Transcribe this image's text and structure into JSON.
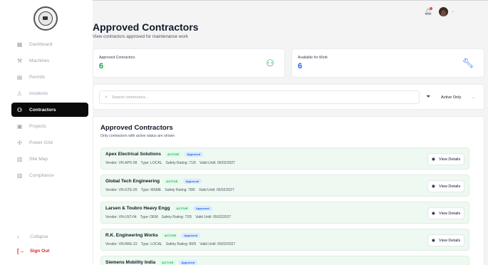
{
  "sidebar": {
    "items": [
      {
        "label": "Dashboard",
        "icon": "dashboard-icon",
        "glyph": "▦",
        "active": false
      },
      {
        "label": "Machines",
        "icon": "wrench-icon",
        "glyph": "⚒",
        "active": false
      },
      {
        "label": "Permits",
        "icon": "document-icon",
        "glyph": "▤",
        "active": false
      },
      {
        "label": "Incidents",
        "icon": "warning-icon",
        "glyph": "⚠",
        "active": false
      },
      {
        "label": "Contractors",
        "icon": "users-icon",
        "glyph": "⚇",
        "active": true
      },
      {
        "label": "Projects",
        "icon": "briefcase-icon",
        "glyph": "▣",
        "active": false
      },
      {
        "label": "Power Grid",
        "icon": "grid-icon",
        "glyph": "✣",
        "active": false
      },
      {
        "label": "Site Map",
        "icon": "map-icon",
        "glyph": "▥",
        "active": false
      },
      {
        "label": "Compliance",
        "icon": "clipboard-icon",
        "glyph": "▧",
        "active": false
      }
    ],
    "collapse_label": "Collapse",
    "signout_label": "Sign Out"
  },
  "header": {
    "title": "Approved Contractors",
    "subtitle": "View contractors approved for maintenance work"
  },
  "stats": [
    {
      "label": "Approved Contractors",
      "value": "6",
      "color": "#16a34a"
    },
    {
      "label": "Available for Work",
      "value": "6",
      "color": "#2563eb"
    }
  ],
  "search": {
    "placeholder": "Search contractors...",
    "filter_value": "Active Only"
  },
  "list": {
    "title": "Approved Contractors",
    "subtitle": "Only contractors with active status are shown",
    "view_label": "View Details",
    "rows": [
      {
        "name": "Apex Electrical Solutions",
        "status": "ACTIVE",
        "approval": "Approved",
        "vendor": "Vendor: VN-APX-99",
        "type": "Type: LOCAL",
        "rating": "Safety Rating: 71/5",
        "valid": "Valid Until: 05/02/2027"
      },
      {
        "name": "Global Tech Engineering",
        "status": "ACTIVE",
        "approval": "Approved",
        "vendor": "Vendor: VN-GTE-55",
        "type": "Type: MSME",
        "rating": "Safety Rating: 78/5",
        "valid": "Valid Until: 05/02/2027"
      },
      {
        "name": "Larsen & Toubro Heavy Engg",
        "status": "ACTIVE",
        "approval": "Approved",
        "vendor": "Vendor: VN-LNT-04",
        "type": "Type: OEM",
        "rating": "Safety Rating: 72/5",
        "valid": "Valid Until: 05/02/2027"
      },
      {
        "name": "R.K. Engineering Works",
        "status": "ACTIVE",
        "approval": "Approved",
        "vendor": "Vendor: VN-RKE-22",
        "type": "Type: LOCAL",
        "rating": "Safety Rating: 80/5",
        "valid": "Valid Until: 05/02/2027"
      },
      {
        "name": "Siemens Mobility India",
        "status": "ACTIVE",
        "approval": "Approved",
        "vendor": "",
        "type": "",
        "rating": "",
        "valid": ""
      }
    ]
  }
}
